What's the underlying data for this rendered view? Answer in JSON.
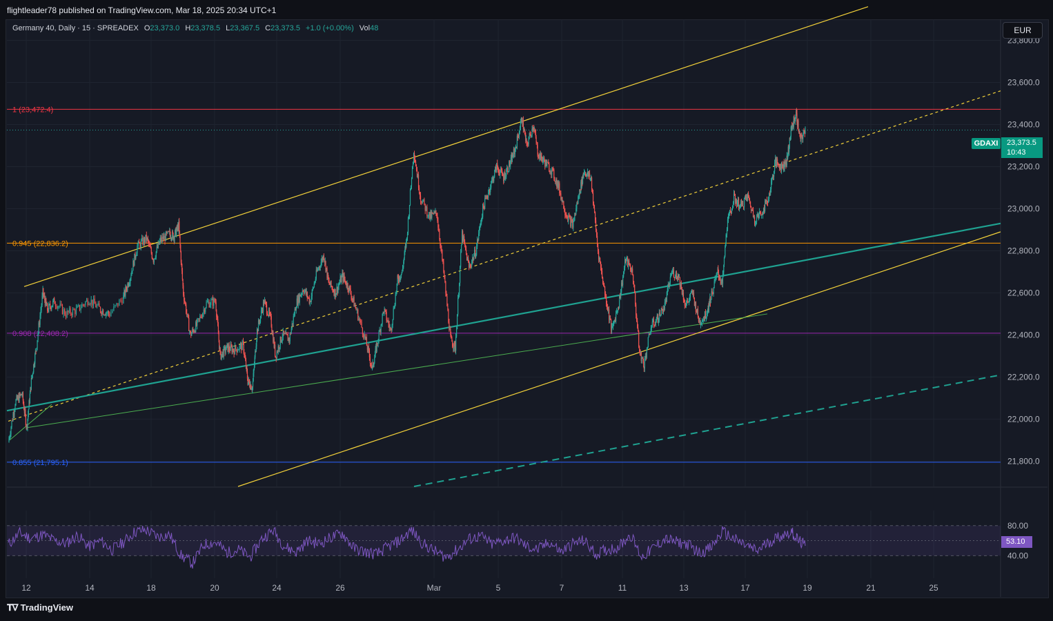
{
  "header": {
    "published": "flightleader78 published on TradingView.com, Mar 18, 2025 20:34 UTC+1"
  },
  "legend": {
    "symbol": "Germany 40, Daily · 15 · SPREADEX",
    "o_label": "O",
    "o_value": "23,373.0",
    "h_label": "H",
    "h_value": "23,378.5",
    "l_label": "L",
    "l_value": "23,367.5",
    "c_label": "C",
    "c_value": "23,373.5",
    "change": "+1.0 (+0.00%)",
    "vol_label": "Vol",
    "vol_value": "48"
  },
  "currency_button": "EUR",
  "last_price": {
    "symbol": "GDAXI",
    "price": "23,373.5",
    "countdown": "10:43",
    "color": "#089981"
  },
  "rsi": {
    "value_label": "53.10",
    "levels": [
      "80.00",
      "40.00"
    ],
    "color": "#7e57c2"
  },
  "footer": {
    "brand": "TradingView"
  },
  "chart_data": {
    "type": "candlestick",
    "timeframe": "15m",
    "colors": {
      "up": "#26a69a",
      "down": "#ef5350",
      "rsi": "#7e57c2",
      "channel": "#f5d33a",
      "teal_line": "#1fa291",
      "green_line": "#4caf50"
    },
    "x_ticks": [
      "12",
      "14",
      "18",
      "20",
      "24",
      "26",
      "Mar",
      "5",
      "7",
      "11",
      "13",
      "17",
      "19",
      "21",
      "25"
    ],
    "y_ticks": [
      "23,800.0",
      "23,600.0",
      "23,400.0",
      "23,200.0",
      "23,000.0",
      "22,800.0",
      "22,600.0",
      "22,400.0",
      "22,200.0",
      "22,000.0",
      "21,800.0"
    ],
    "y_tick_values": [
      23800,
      23600,
      23400,
      23200,
      23000,
      22800,
      22600,
      22400,
      22200,
      22000,
      21800
    ],
    "ylim": [
      21680,
      23900
    ],
    "fib_levels": [
      {
        "label": "1 (23,472.4)",
        "value": 23472.4,
        "color": "#f23645"
      },
      {
        "label": "0.945 (22,836.2)",
        "value": 22836.2,
        "color": "#ff9800"
      },
      {
        "label": "0.908 (22,408.2)",
        "value": 22408.2,
        "color": "#9c27b0"
      },
      {
        "label": "0.855 (21,795.1)",
        "value": 21795.1,
        "color": "#2962ff"
      }
    ],
    "close_path": [
      [
        12.0,
        21890
      ],
      [
        12.3,
        22080
      ],
      [
        12.6,
        22120
      ],
      [
        12.8,
        21960
      ],
      [
        13.0,
        22180
      ],
      [
        13.2,
        22330
      ],
      [
        13.5,
        22600
      ],
      [
        13.7,
        22520
      ],
      [
        14.0,
        22560
      ],
      [
        14.5,
        22500
      ],
      [
        15.0,
        22520
      ],
      [
        15.5,
        22570
      ],
      [
        16.0,
        22520
      ],
      [
        16.4,
        22500
      ],
      [
        17.0,
        22580
      ],
      [
        17.3,
        22680
      ],
      [
        17.6,
        22820
      ],
      [
        18.0,
        22860
      ],
      [
        18.3,
        22760
      ],
      [
        18.6,
        22850
      ],
      [
        19.0,
        22880
      ],
      [
        19.2,
        22870
      ],
      [
        19.4,
        22920
      ],
      [
        19.6,
        22600
      ],
      [
        19.9,
        22400
      ],
      [
        20.2,
        22450
      ],
      [
        20.6,
        22550
      ],
      [
        21.0,
        22560
      ],
      [
        21.2,
        22300
      ],
      [
        21.5,
        22340
      ],
      [
        21.8,
        22330
      ],
      [
        22.2,
        22350
      ],
      [
        22.4,
        22180
      ],
      [
        22.6,
        22150
      ],
      [
        22.8,
        22420
      ],
      [
        23.1,
        22560
      ],
      [
        23.4,
        22470
      ],
      [
        23.6,
        22300
      ],
      [
        23.9,
        22400
      ],
      [
        24.2,
        22380
      ],
      [
        24.5,
        22550
      ],
      [
        24.8,
        22620
      ],
      [
        25.1,
        22560
      ],
      [
        25.4,
        22700
      ],
      [
        25.7,
        22780
      ],
      [
        25.9,
        22650
      ],
      [
        26.2,
        22600
      ],
      [
        26.5,
        22680
      ],
      [
        26.8,
        22620
      ],
      [
        27.1,
        22520
      ],
      [
        27.5,
        22380
      ],
      [
        27.8,
        22240
      ],
      [
        28.0,
        22350
      ],
      [
        28.3,
        22520
      ],
      [
        28.6,
        22420
      ],
      [
        28.9,
        22660
      ],
      [
        29.1,
        22700
      ],
      [
        29.3,
        22860
      ],
      [
        29.6,
        23280
      ],
      [
        29.9,
        23050
      ],
      [
        30.3,
        22960
      ],
      [
        30.6,
        22980
      ],
      [
        30.9,
        22700
      ],
      [
        31.2,
        22380
      ],
      [
        31.4,
        22340
      ],
      [
        31.7,
        22880
      ],
      [
        32.0,
        22720
      ],
      [
        32.3,
        22800
      ],
      [
        32.6,
        23000
      ],
      [
        32.9,
        23100
      ],
      [
        33.2,
        23200
      ],
      [
        33.5,
        23150
      ],
      [
        33.8,
        23220
      ],
      [
        34.0,
        23280
      ],
      [
        34.3,
        23430
      ],
      [
        34.5,
        23300
      ],
      [
        34.8,
        23400
      ],
      [
        35.0,
        23260
      ],
      [
        35.3,
        23220
      ],
      [
        35.6,
        23180
      ],
      [
        35.9,
        23100
      ],
      [
        36.2,
        22980
      ],
      [
        36.5,
        22920
      ],
      [
        36.8,
        23080
      ],
      [
        37.0,
        23180
      ],
      [
        37.3,
        23140
      ],
      [
        37.6,
        22800
      ],
      [
        37.9,
        22600
      ],
      [
        38.2,
        22420
      ],
      [
        38.5,
        22550
      ],
      [
        38.8,
        22760
      ],
      [
        39.1,
        22700
      ],
      [
        39.4,
        22320
      ],
      [
        39.6,
        22260
      ],
      [
        39.9,
        22440
      ],
      [
        40.2,
        22480
      ],
      [
        40.5,
        22540
      ],
      [
        40.8,
        22700
      ],
      [
        41.1,
        22680
      ],
      [
        41.4,
        22540
      ],
      [
        41.7,
        22600
      ],
      [
        42.0,
        22460
      ],
      [
        42.3,
        22500
      ],
      [
        42.5,
        22580
      ],
      [
        42.8,
        22700
      ],
      [
        43.0,
        22640
      ],
      [
        43.2,
        22920
      ],
      [
        43.5,
        23050
      ],
      [
        43.8,
        23010
      ],
      [
        44.1,
        23060
      ],
      [
        44.4,
        22950
      ],
      [
        44.7,
        22980
      ],
      [
        45.0,
        23050
      ],
      [
        45.3,
        23220
      ],
      [
        45.6,
        23200
      ],
      [
        45.8,
        23230
      ],
      [
        46.0,
        23380
      ],
      [
        46.2,
        23450
      ],
      [
        46.4,
        23320
      ],
      [
        46.6,
        23380
      ]
    ],
    "rsi_path": [
      [
        12.0,
        55
      ],
      [
        12.5,
        70
      ],
      [
        13.0,
        63
      ],
      [
        13.5,
        68
      ],
      [
        14.0,
        60
      ],
      [
        14.5,
        56
      ],
      [
        15.0,
        67
      ],
      [
        15.5,
        52
      ],
      [
        16.0,
        60
      ],
      [
        16.5,
        48
      ],
      [
        17.0,
        58
      ],
      [
        17.5,
        72
      ],
      [
        18.0,
        74
      ],
      [
        18.5,
        65
      ],
      [
        19.0,
        68
      ],
      [
        19.5,
        40
      ],
      [
        20.0,
        30
      ],
      [
        20.5,
        55
      ],
      [
        21.0,
        58
      ],
      [
        21.5,
        44
      ],
      [
        22.0,
        48
      ],
      [
        22.5,
        38
      ],
      [
        23.0,
        62
      ],
      [
        23.5,
        74
      ],
      [
        24.0,
        52
      ],
      [
        24.5,
        45
      ],
      [
        25.0,
        60
      ],
      [
        25.5,
        56
      ],
      [
        26.0,
        64
      ],
      [
        26.5,
        70
      ],
      [
        27.0,
        50
      ],
      [
        27.5,
        45
      ],
      [
        28.0,
        42
      ],
      [
        28.5,
        52
      ],
      [
        29.0,
        60
      ],
      [
        29.5,
        74
      ],
      [
        30.0,
        56
      ],
      [
        30.5,
        46
      ],
      [
        31.0,
        38
      ],
      [
        31.5,
        48
      ],
      [
        32.0,
        62
      ],
      [
        32.5,
        66
      ],
      [
        33.0,
        55
      ],
      [
        33.5,
        60
      ],
      [
        34.0,
        64
      ],
      [
        34.5,
        52
      ],
      [
        35.0,
        48
      ],
      [
        35.5,
        58
      ],
      [
        36.0,
        45
      ],
      [
        36.5,
        56
      ],
      [
        37.0,
        60
      ],
      [
        37.5,
        42
      ],
      [
        38.0,
        48
      ],
      [
        38.5,
        52
      ],
      [
        39.0,
        68
      ],
      [
        39.5,
        38
      ],
      [
        40.0,
        50
      ],
      [
        40.5,
        62
      ],
      [
        41.0,
        58
      ],
      [
        41.5,
        55
      ],
      [
        42.0,
        44
      ],
      [
        42.5,
        50
      ],
      [
        43.0,
        72
      ],
      [
        43.5,
        62
      ],
      [
        44.0,
        54
      ],
      [
        44.5,
        46
      ],
      [
        45.0,
        58
      ],
      [
        45.5,
        66
      ],
      [
        46.0,
        72
      ],
      [
        46.3,
        60
      ],
      [
        46.6,
        53.1
      ]
    ],
    "rsi_ylim": [
      10,
      100
    ],
    "rsi_bands": [
      80,
      60,
      40
    ]
  }
}
